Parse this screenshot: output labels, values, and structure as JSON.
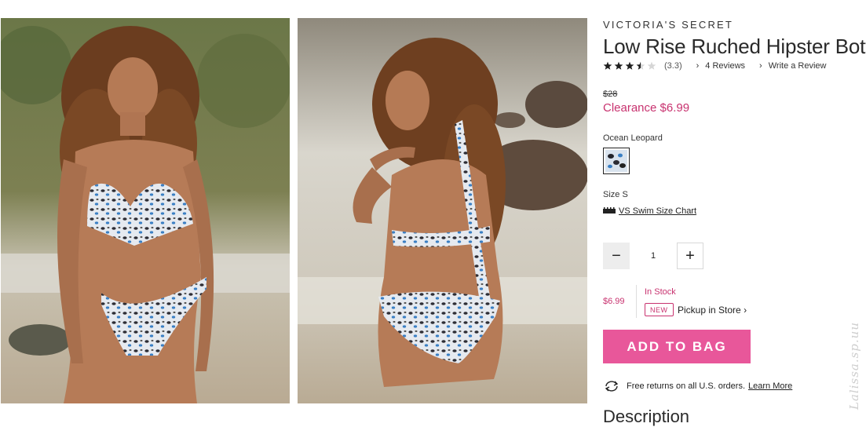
{
  "images": [
    {
      "alt_icon": "product-photo-front"
    },
    {
      "alt_icon": "product-photo-back"
    }
  ],
  "product": {
    "brand": "VICTORIA'S SECRET",
    "title": "Low Rise Ruched Hipster Bottom",
    "rating": 3.3,
    "rating_text": "(3.3)",
    "reviews_link": "4 Reviews",
    "write_review_link": "Write a Review",
    "original_price": "$28",
    "sale_price": "Clearance $6.99",
    "color_name": "Ocean Leopard",
    "size_label": "Size S",
    "size_chart_link": "VS Swim Size Chart",
    "quantity": "1",
    "unit_price": "$6.99",
    "stock_status": "In Stock",
    "new_badge": "NEW",
    "pickup_link": "Pickup in Store",
    "add_to_bag": "ADD TO BAG",
    "returns_text": "Free returns on all U.S. orders.",
    "learn_more": "Learn More",
    "description_heading": "Description"
  },
  "watermark": "Lalissa.sp.uu",
  "colors": {
    "accent_pink": "#e8579a",
    "sale_text": "#c8326f"
  }
}
